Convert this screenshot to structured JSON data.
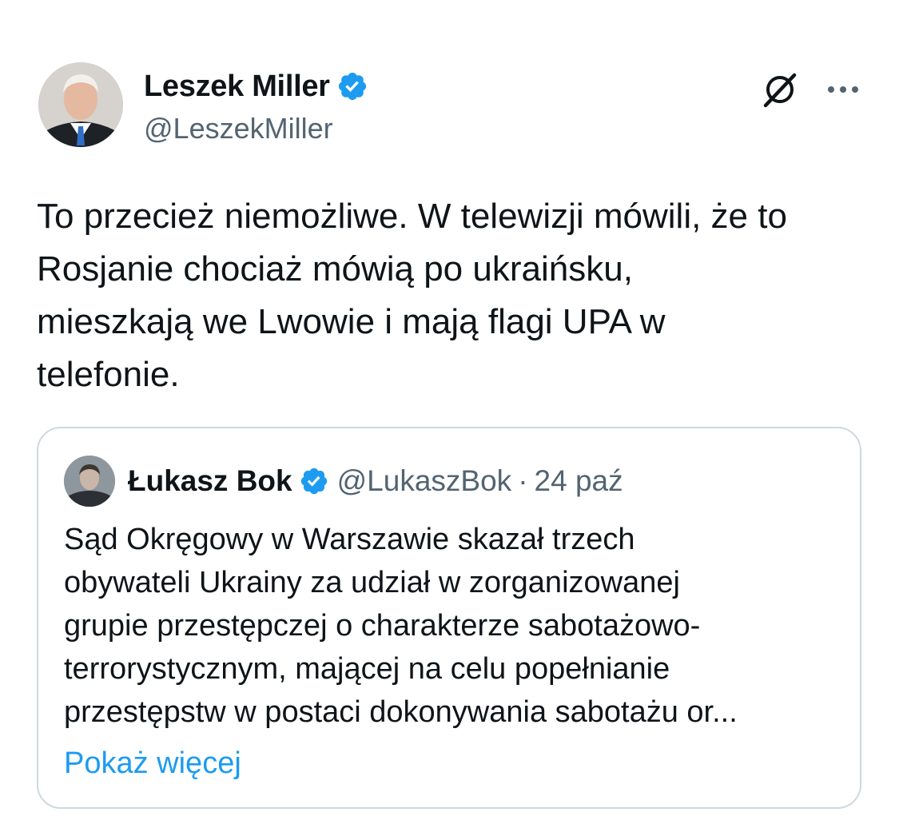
{
  "tweet": {
    "author_name": "Leszek Miller",
    "author_handle": "@LeszekMiller",
    "text": "To przecież niemożliwe. W telewizji mówili, że to\nRosjanie chociaż mówią po ukraińsku,\nmieszkają we Lwowie i mają flagi UPA w\ntelefonie.",
    "verified_icon": "verified-badge-icon",
    "grok_icon": "grok-icon",
    "more_icon": "more-options-icon"
  },
  "quoted": {
    "author_name": "Łukasz Bok",
    "author_handle": "@LukaszBok",
    "separator": "·",
    "date": "24 paź",
    "text": "Sąd Okręgowy w Warszawie skazał trzech\nobywateli Ukrainy za udział w zorganizowanej\ngrupie przestępczej o charakterze sabotażowo-\nterrorystycznym, mającej na celu popełnianie\nprzestępstw w postaci dokonywania sabotażu or...",
    "show_more": "Pokaż więcej"
  },
  "colors": {
    "text": "#0f1419",
    "secondary": "#536471",
    "accent": "#1d9bf0",
    "border": "#cfd9de"
  }
}
